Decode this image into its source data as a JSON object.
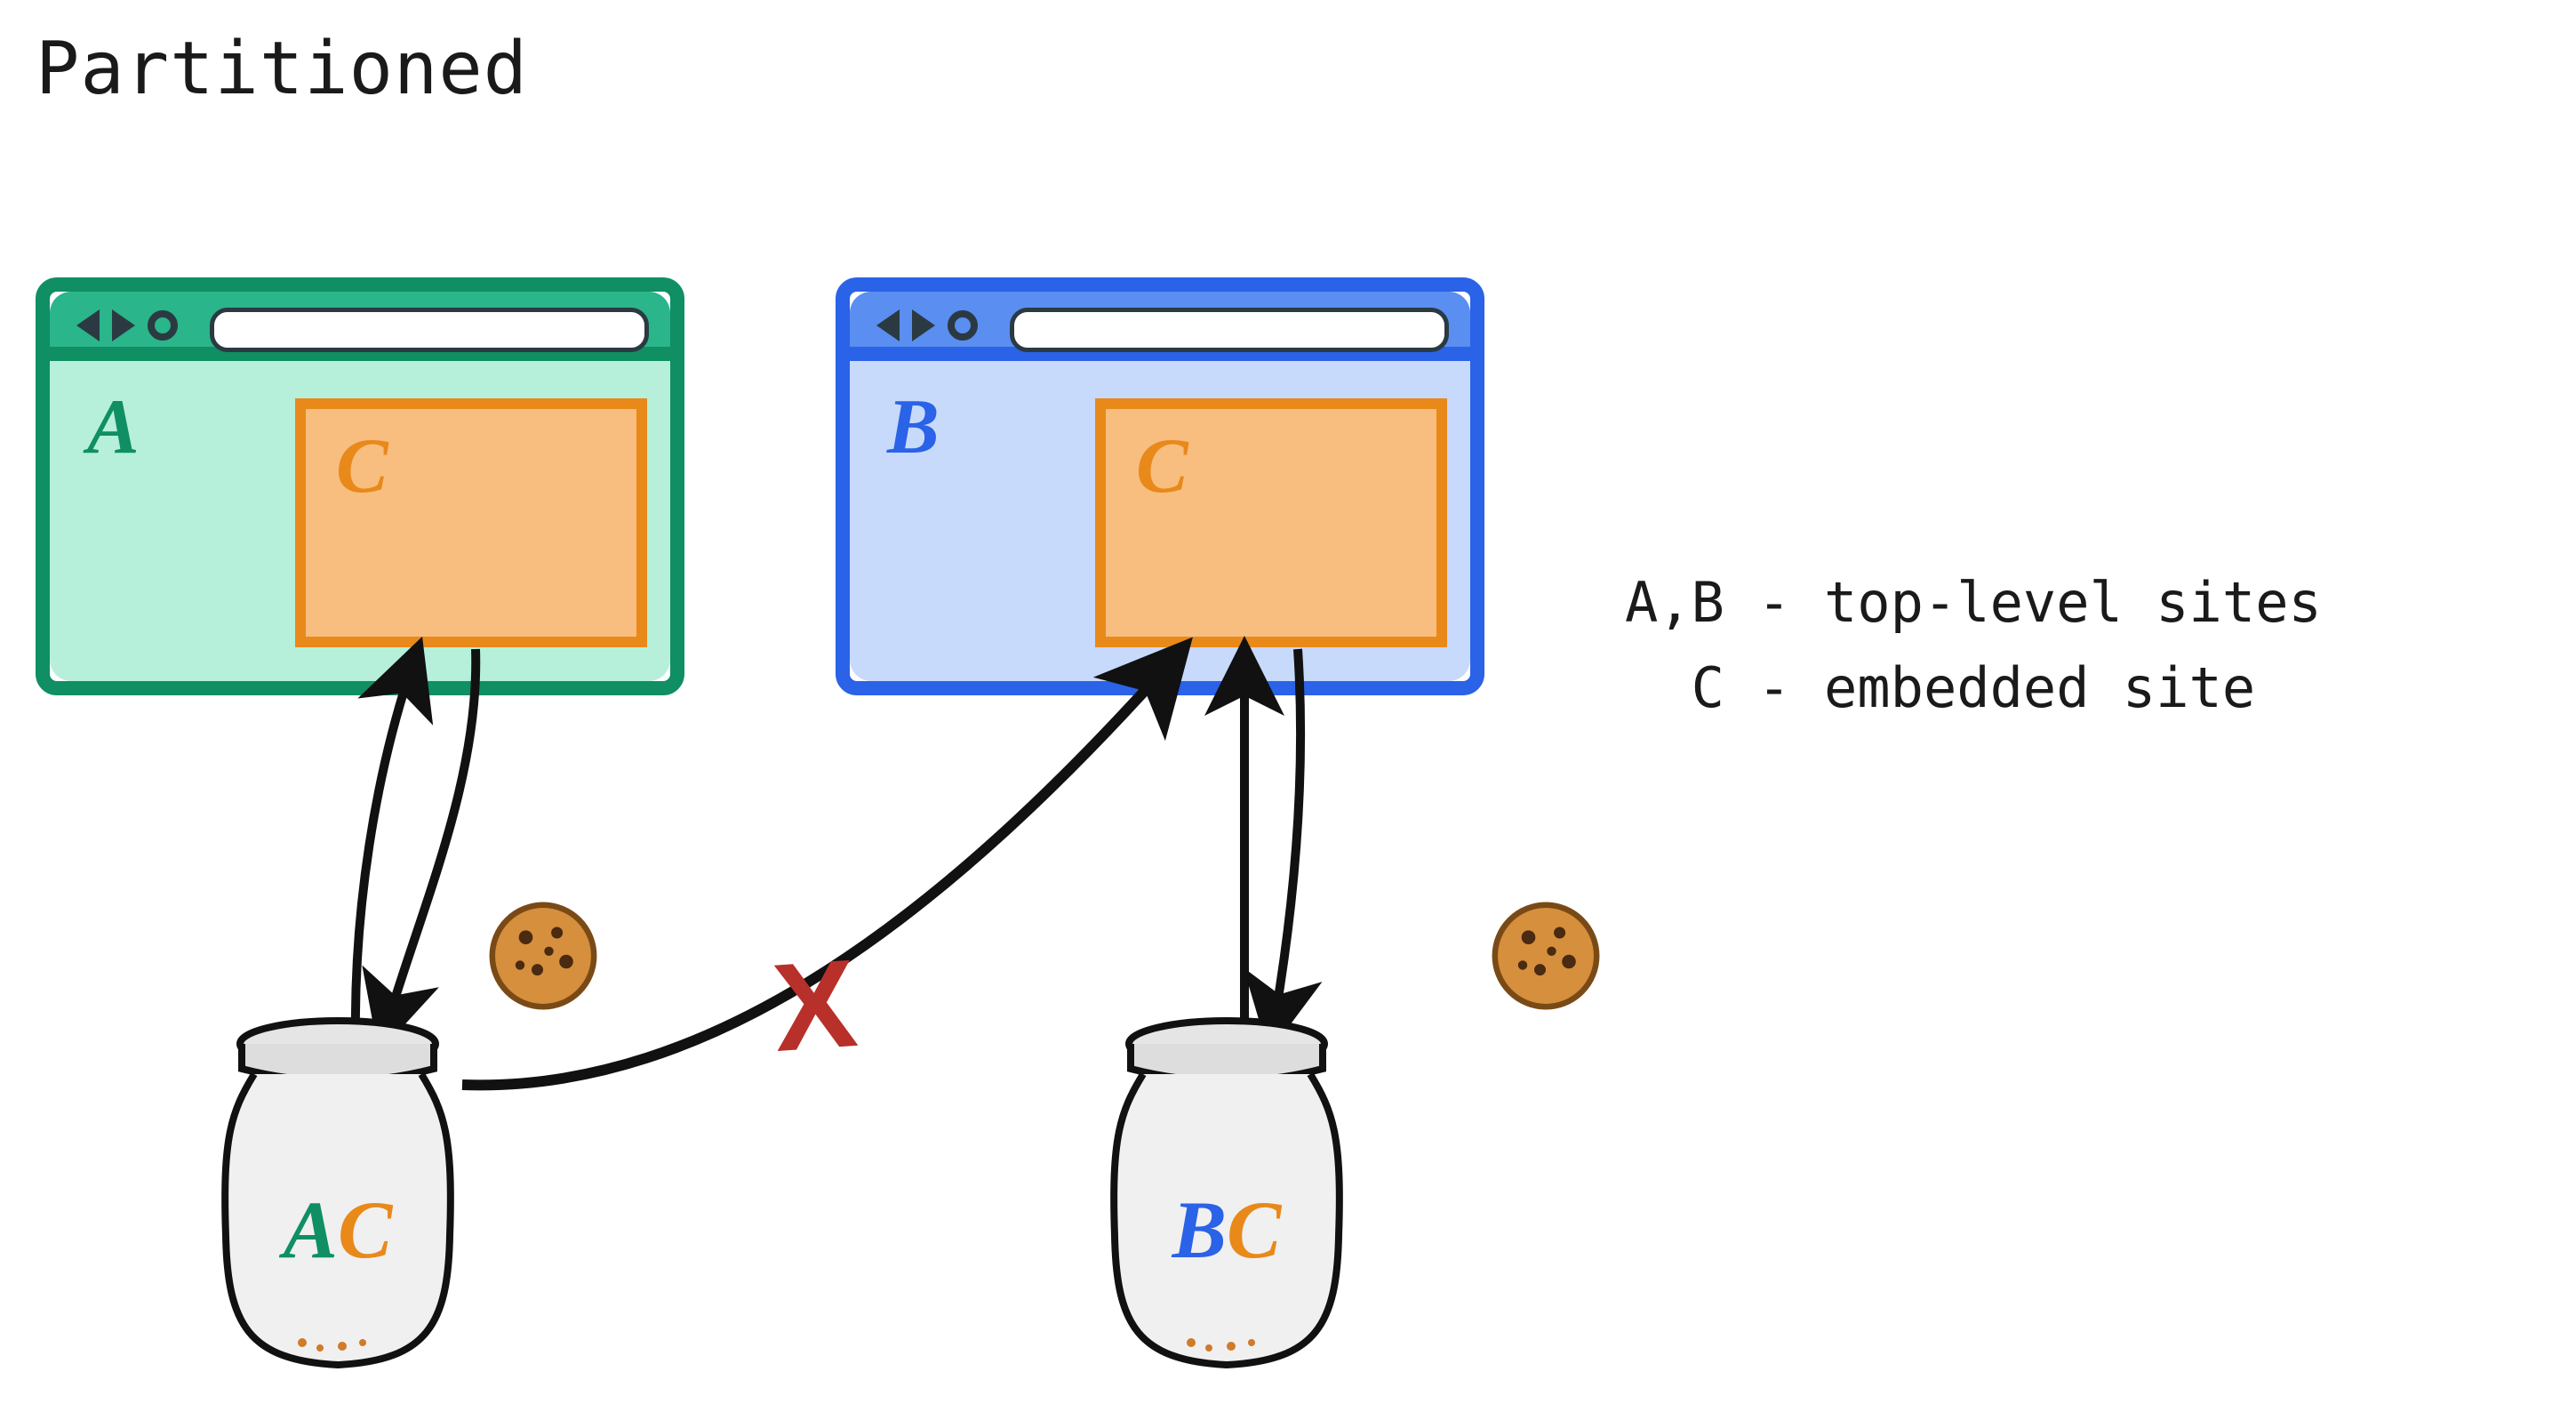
{
  "title": "Partitioned",
  "legend_line1": "A,B - top-level sites",
  "legend_line2": "  C - embedded site",
  "browsers": {
    "A": {
      "top_site_label": "A",
      "embedded_label": "C",
      "color": "#0f8f63",
      "bg": "#b6f0da"
    },
    "B": {
      "top_site_label": "B",
      "embedded_label": "C",
      "color": "#2a62e8",
      "bg": "#c8dafb"
    }
  },
  "embed_color": "#e8891a",
  "jars": {
    "A": {
      "part1": "A",
      "part1_color": "#0f8f63",
      "part2": "C",
      "part2_color": "#e8891a"
    },
    "B": {
      "part1": "B",
      "part1_color": "#2a62e8",
      "part2": "C",
      "part2_color": "#e8891a"
    }
  },
  "block_mark": "X",
  "cookies": [
    "cookie-a",
    "cookie-b"
  ],
  "relationships": {
    "jarA_to_embedA": "bidirectional-allowed",
    "jarB_to_embedB": "bidirectional-allowed",
    "jarA_to_embedB": "blocked"
  }
}
